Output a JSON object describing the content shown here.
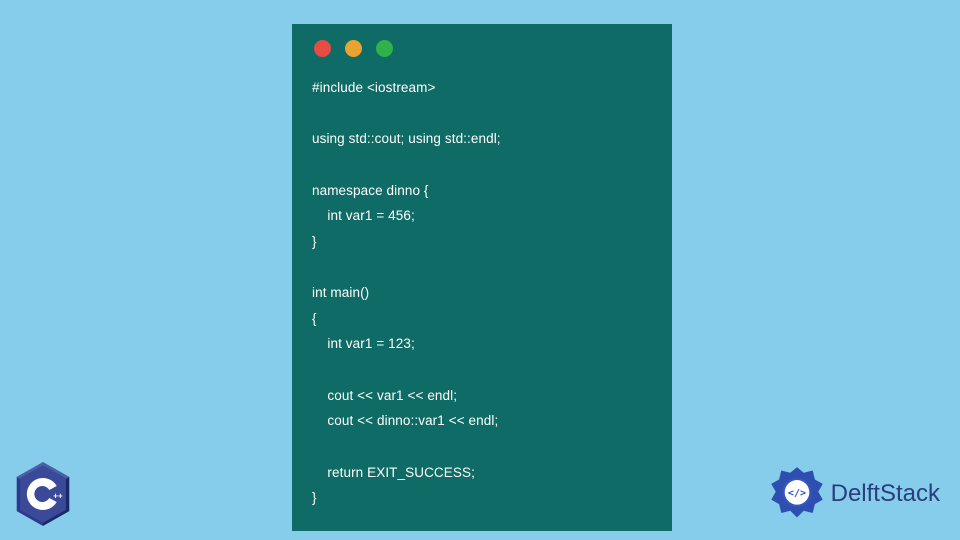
{
  "code": {
    "lines": "#include <iostream>\n\nusing std::cout; using std::endl;\n\nnamespace dinno {\n    int var1 = 456;\n}\n\nint main()\n{\n    int var1 = 123;\n\n    cout << var1 << endl;\n    cout << dinno::var1 << endl;\n\n    return EXIT_SUCCESS;\n}"
  },
  "cpp_badge": {
    "label": "C",
    "suffix": "++"
  },
  "brand": {
    "name": "DelftStack"
  },
  "colors": {
    "background": "#86cdec",
    "window": "#0f6b65",
    "code_text": "#ffffff",
    "brand_text": "#2a3d7c",
    "brand_icon": "#2f4fb0",
    "cpp_hex": "#2b3a8f"
  }
}
